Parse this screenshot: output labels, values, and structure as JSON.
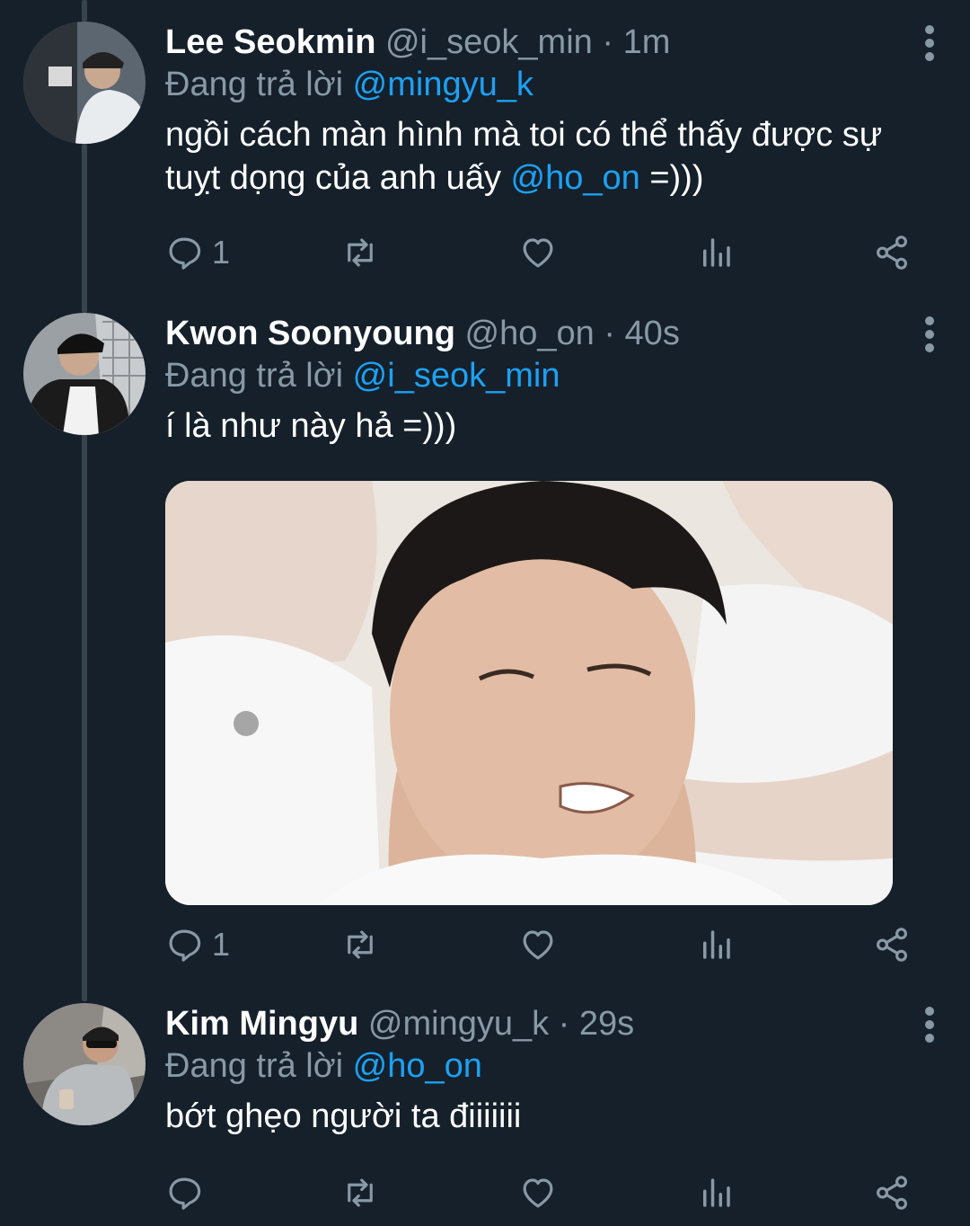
{
  "tweets": [
    {
      "name": "Lee Seokmin",
      "handle": "@i_seok_min",
      "sep": "·",
      "time": "1m",
      "reply_prefix": "Đang trả lời",
      "reply_to": "@mingyu_k",
      "text_before": "ngồi cách màn hình mà toi có thể thấy được sự tuỵt dọng của anh uấy",
      "mention": "@ho_on",
      "text_after": "=)))",
      "reply_count": "1"
    },
    {
      "name": "Kwon Soonyoung",
      "handle": "@ho_on",
      "sep": "·",
      "time": "40s",
      "reply_prefix": "Đang trả lời",
      "reply_to": "@i_seok_min",
      "text": "í là như này hả =)))",
      "reply_count": "1"
    },
    {
      "name": "Kim Mingyu",
      "handle": "@mingyu_k",
      "sep": "·",
      "time": "29s",
      "reply_prefix": "Đang trả lời",
      "reply_to": "@ho_on",
      "text": "bớt ghẹo người ta điiiiiii",
      "reply_count": ""
    }
  ],
  "icons": {
    "reply": "reply-icon",
    "retweet": "retweet-icon",
    "like": "heart-icon",
    "analytics": "analytics-icon",
    "share": "share-icon",
    "more": "more-vertical-icon"
  },
  "colors": {
    "background": "#15202b",
    "accent": "#1da1f2",
    "muted": "#8899a6",
    "text": "#ffffff"
  }
}
